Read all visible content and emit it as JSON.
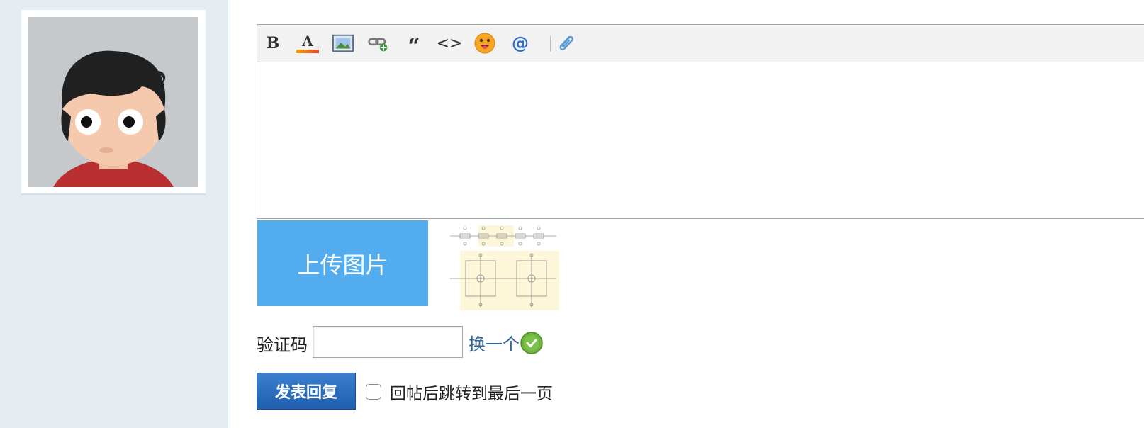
{
  "editor": {
    "toolbar": [
      {
        "name": "bold-button",
        "icon": "bold-icon",
        "glyph": "B"
      },
      {
        "name": "font-color-button",
        "icon": "font-color-icon",
        "glyph": "A"
      },
      {
        "name": "insert-image-button",
        "icon": "image-icon"
      },
      {
        "name": "insert-link-button",
        "icon": "link-add-icon"
      },
      {
        "name": "quote-button",
        "icon": "quote-icon",
        "glyph": "“"
      },
      {
        "name": "code-button",
        "icon": "code-icon",
        "glyph": "<>"
      },
      {
        "name": "emoji-button",
        "icon": "smiley-icon"
      },
      {
        "name": "mention-button",
        "icon": "at-icon",
        "glyph": "@"
      },
      {
        "name": "attachment-button",
        "icon": "paperclip-icon"
      }
    ],
    "content": ""
  },
  "upload": {
    "label": "上传图片"
  },
  "captcha": {
    "label": "验证码",
    "value": "",
    "change_label": "换一个",
    "status_icon": "check-circle-icon"
  },
  "submit": {
    "label": "发表回复"
  },
  "jump": {
    "label": "回帖后跳转到最后一页",
    "checked": false
  },
  "colors": {
    "sidebar": "#e5edf2",
    "upload": "#52acee",
    "link": "#336699",
    "submit": "#1e5fae",
    "ok": "#6db33f"
  }
}
